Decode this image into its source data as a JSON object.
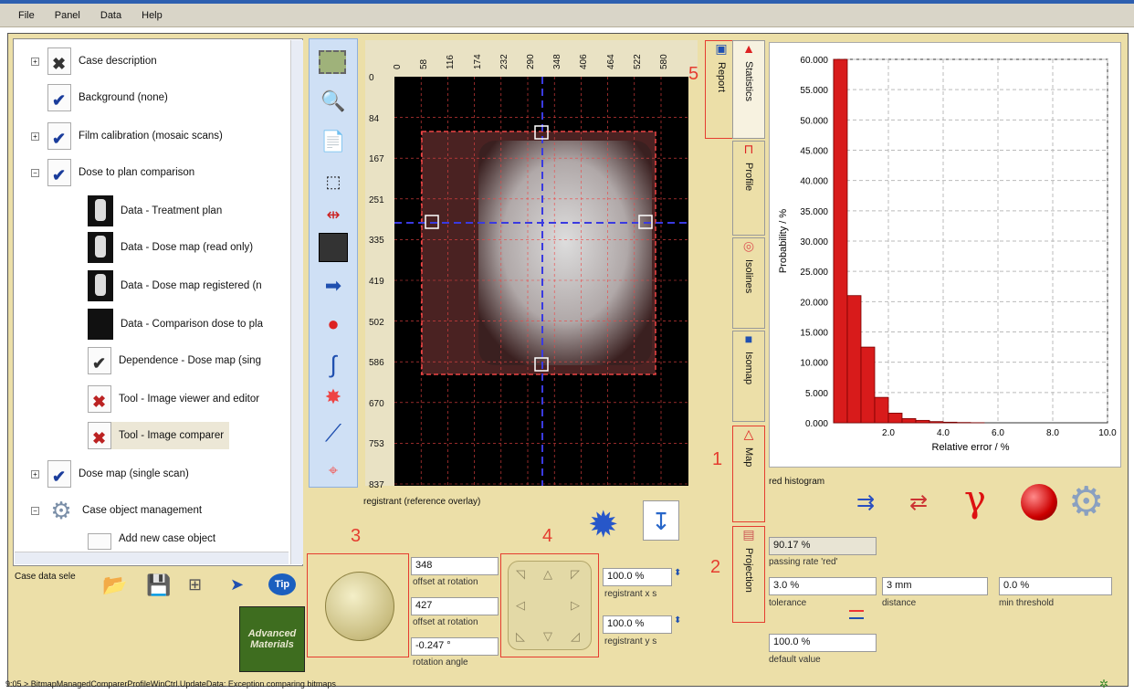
{
  "menu": [
    "File",
    "Panel",
    "Data",
    "Help"
  ],
  "tree": {
    "items": [
      {
        "label": "Case description",
        "icon": "case-description-icon"
      },
      {
        "label": "Background (none)",
        "icon": "document-check-icon"
      },
      {
        "label": "Film calibration (mosaic scans)",
        "icon": "document-check-icon"
      },
      {
        "label": "Dose to plan comparison",
        "icon": "document-check-icon"
      },
      {
        "label": "Data - Treatment plan",
        "icon": "dose-thumbnail-icon"
      },
      {
        "label": "Data - Dose map (read only)",
        "icon": "dose-thumbnail-icon"
      },
      {
        "label": "Data - Dose map registered (n",
        "icon": "dose-thumbnail-icon"
      },
      {
        "label": "Data - Comparison dose to pla",
        "icon": "black-thumbnail-icon"
      },
      {
        "label": "Dependence - Dose map (sing",
        "icon": "document-check-icon"
      },
      {
        "label": "Tool - Image viewer and editor",
        "icon": "tool-icon"
      },
      {
        "label": "Tool - Image comparer",
        "icon": "tool-icon"
      },
      {
        "label": "Dose map (single scan)",
        "icon": "document-check-icon"
      },
      {
        "label": "Case object management",
        "icon": "gear-icon"
      },
      {
        "label": "Add new case object",
        "icon": "document-icon"
      }
    ],
    "footer_label": "Case data sele"
  },
  "ruler": {
    "x_ticks": [
      "0",
      "58",
      "116",
      "174",
      "232",
      "290",
      "348",
      "406",
      "464",
      "522",
      "580"
    ],
    "y_ticks": [
      "0",
      "84",
      "167",
      "251",
      "335",
      "419",
      "502",
      "586",
      "670",
      "753",
      "837"
    ]
  },
  "image_caption": "registrant (reference overlay)",
  "tabs": {
    "report": "Report",
    "statistics": "Statistics",
    "profile": "Profile",
    "isolines": "Isolines",
    "isomap": "Isomap",
    "map": "Map",
    "projection": "Projection"
  },
  "chart_data": {
    "type": "bar",
    "xlabel": "Relative error / %",
    "ylabel": "Probability / %",
    "xlim": [
      0,
      10
    ],
    "ylim": [
      0,
      60
    ],
    "x_ticks": [
      "2.0",
      "4.0",
      "6.0",
      "8.0",
      "10.0"
    ],
    "y_ticks": [
      "0.000",
      "5.000",
      "10.000",
      "15.000",
      "20.000",
      "25.000",
      "30.000",
      "35.000",
      "40.000",
      "45.000",
      "50.000",
      "55.000",
      "60.000"
    ],
    "bin_width": 0.5,
    "bin_starts": [
      0,
      0.5,
      1.0,
      1.5,
      2.0,
      2.5,
      3.0,
      3.5,
      4.0,
      4.5,
      5.0
    ],
    "values": [
      60.0,
      21.0,
      12.5,
      4.2,
      1.6,
      0.7,
      0.4,
      0.2,
      0.1,
      0.05,
      0.02
    ],
    "color": "#d81b1b",
    "grid": true
  },
  "histogram_label": "red histogram",
  "results": {
    "passing_rate": "90.17 %",
    "passing_rate_label": "passing rate 'red'",
    "tolerance": "3.0 %",
    "tolerance_label": "tolerance",
    "distance": "3 mm",
    "distance_label": "distance",
    "min_threshold": "0.0 %",
    "min_threshold_label": "min threshold",
    "default_value": "100.0 %",
    "default_value_label": "default value"
  },
  "registration": {
    "offset_x": "348",
    "offset_x_label": "offset at rotation",
    "offset_y": "427",
    "offset_y_label": "offset at rotation",
    "rotation": "-0.247 °",
    "rotation_label": "rotation angle",
    "scale_x": "100.0 %",
    "scale_x_label": "registrant x s",
    "scale_y": "100.0 %",
    "scale_y_label": "registrant y s"
  },
  "callouts": [
    "1",
    "2",
    "3",
    "4",
    "5"
  ],
  "logo_text": "Advanced Materials",
  "status_text": "9:05 > BitmapManagedComparerProfileWinCtrl.UpdateData: Exception comparing bitmaps"
}
